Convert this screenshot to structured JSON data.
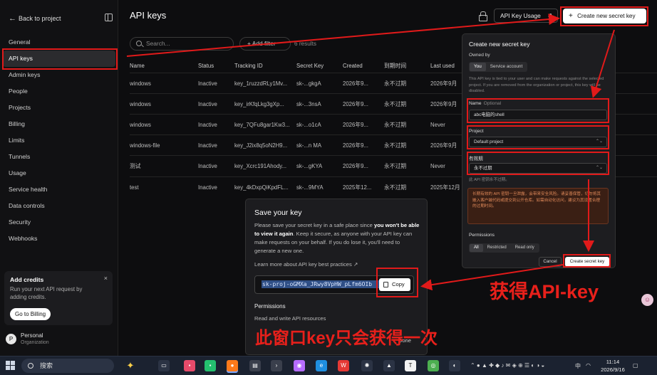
{
  "sidebar": {
    "back_label": "Back to project",
    "items": [
      {
        "label": "General"
      },
      {
        "label": "API keys",
        "active": true
      },
      {
        "label": "Admin keys"
      },
      {
        "label": "People"
      },
      {
        "label": "Projects"
      },
      {
        "label": "Billing"
      },
      {
        "label": "Limits"
      },
      {
        "label": "Tunnels"
      },
      {
        "label": "Usage"
      },
      {
        "label": "Service health"
      },
      {
        "label": "Data controls"
      },
      {
        "label": "Security"
      },
      {
        "label": "Webhooks"
      }
    ],
    "credits": {
      "title": "Add credits",
      "description": "Run your next API request by adding credits.",
      "button": "Go to Billing",
      "close": "×"
    },
    "profile": {
      "initial": "P",
      "name": "Personal",
      "sub": "Organization"
    }
  },
  "header": {
    "title": "API keys",
    "usage_button": "API Key Usage",
    "create_button": "Create new secret key"
  },
  "toolbar": {
    "search_placeholder": "Search...",
    "filter_label": "+  Add filter",
    "results": "6 results"
  },
  "table": {
    "columns": [
      "Name",
      "Status",
      "Tracking ID",
      "Secret Key",
      "Created",
      "到期时间",
      "Last used"
    ],
    "rows": [
      [
        "windows",
        "Inactive",
        "key_1ruzzdRLy1Mv...",
        "sk-...gkgA",
        "2026年9...",
        "永不过期",
        "2026年9月"
      ],
      [
        "windows",
        "Inactive",
        "key_irKfqLkg3gXp...",
        "sk-...3nsA",
        "2026年9...",
        "永不过期",
        "2026年9月"
      ],
      [
        "windows",
        "Inactive",
        "key_7QFu8gar1Kw3...",
        "sk-...o1cA",
        "2026年9...",
        "永不过期",
        "Never"
      ],
      [
        "windows-file",
        "Inactive",
        "key_J2ix8q5oN2H9...",
        "sk-...n MA",
        "2026年9...",
        "永不过期",
        "2026年9月"
      ],
      [
        "测试",
        "Inactive",
        "key_Xcrc191Ahody...",
        "sk-...gKYA",
        "2026年9...",
        "永不过期",
        "Never"
      ],
      [
        "test",
        "Inactive",
        "key_4kDxpQiKpdFL...",
        "sk-...9MYA",
        "2025年12...",
        "永不过期",
        "2025年12月"
      ]
    ]
  },
  "save_dialog": {
    "title": "Save your key",
    "text_a": "Please save your secret key in a safe place since ",
    "text_bold": "you won't be able to view it again",
    "text_b": ". Keep it secure, as anyone with your API key can make requests on your behalf. If you do lose it, you'll need to generate a new one.",
    "learn_more": "Learn more about API key best practices ↗",
    "key_value": "sk-proj-oGMXa_JRwy8VpHW_pLfm6OIb",
    "copy_label": "Copy",
    "permissions_title": "Permissions",
    "permissions_value": "Read and write API resources",
    "done_label": "Done"
  },
  "create_dialog": {
    "title": "Create new secret key",
    "owned_by": "Owned by",
    "owner_options": [
      "You",
      "Service account"
    ],
    "info": "This API key is tied to your user and can make requests against the selected project. If you are removed from the organization or project, this key will be disabled.",
    "name_label": "Name",
    "name_optional": "Optional",
    "name_value": "abc电脑的shell",
    "project_label": "Project",
    "project_value": "Default project",
    "expiry_label": "有效期",
    "expiry_value": "永不过期",
    "expiry_hint": "此 API 密钥永不过期。",
    "warning": "长期有效的 API 密钥一旦泄露，会带来安全风险。请妥善保管，切勿将其嵌入客户端代码或提交到公开仓库。如需自动化访问，建议为其设置合理的过期时间。",
    "permissions_label": "Permissions",
    "permission_options": [
      "All",
      "Restricted",
      "Read only"
    ],
    "cancel_label": "Cancel",
    "create_label": "Create secret key"
  },
  "annotations": {
    "get_key": "获得API-key",
    "once_only": "此窗口key只会获得一次"
  },
  "taskbar": {
    "search_label": "搜索",
    "ime": "中",
    "time": "11:14",
    "date": "2026/9/16"
  },
  "colors": {
    "annotation_red": "#e11a1a",
    "background": "#0d0d0f",
    "warning_text": "#e08a5a"
  }
}
